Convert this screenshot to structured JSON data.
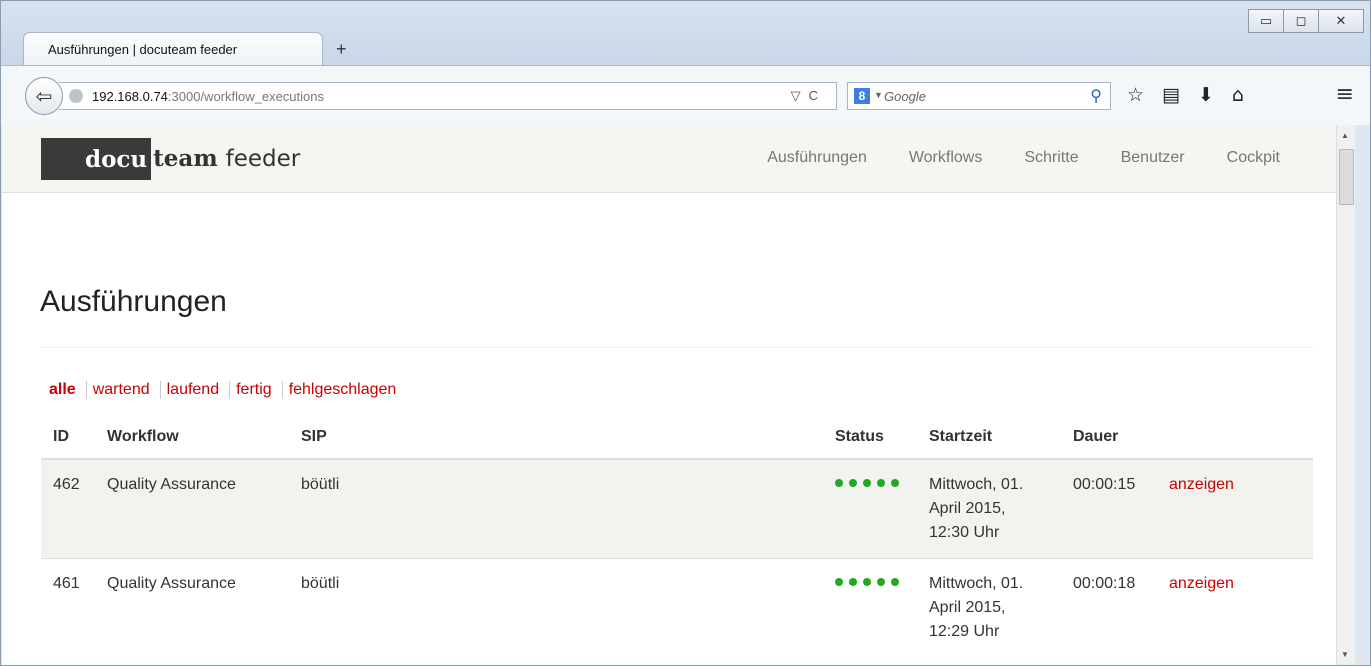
{
  "browser": {
    "tab_title": "Ausführungen | docuteam feeder",
    "new_tab": "+",
    "url_host": "192.168.0.74",
    "url_rest": ":3000/workflow_executions",
    "search_placeholder": "Google",
    "search_engine_icon": "8"
  },
  "site": {
    "logo_docu": "docu",
    "logo_team": "team",
    "logo_feeder": "feeder",
    "nav": [
      "Ausführungen",
      "Workflows",
      "Schritte",
      "Benutzer",
      "Cockpit"
    ]
  },
  "page": {
    "title": "Ausführungen",
    "filters": [
      "alle",
      "wartend",
      "laufend",
      "fertig",
      "fehlgeschlagen"
    ],
    "active_filter": "alle"
  },
  "table": {
    "headers": [
      "ID",
      "Workflow",
      "SIP",
      "Status",
      "Startzeit",
      "Dauer",
      ""
    ],
    "rows": [
      {
        "id": "462",
        "workflow": "Quality Assurance",
        "sip": "böütli",
        "status_steps": 5,
        "start": "Mittwoch, 01. April 2015, 12:30 Uhr",
        "duration": "00:00:15",
        "action": "anzeigen"
      },
      {
        "id": "461",
        "workflow": "Quality Assurance",
        "sip": "böütli",
        "status_steps": 5,
        "start": "Mittwoch, 01. April 2015, 12:29 Uhr",
        "duration": "00:00:18",
        "action": "anzeigen"
      }
    ]
  },
  "colors": {
    "accent": "#cc0000",
    "status_ok": "#22a822"
  }
}
